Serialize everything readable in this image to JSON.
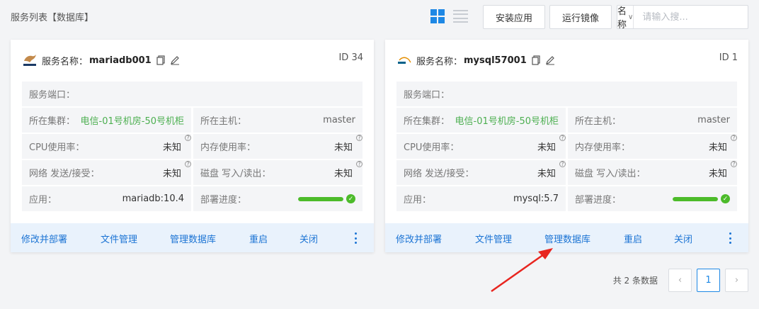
{
  "header": {
    "title": "服务列表【数据库】",
    "view_grid_icon": "grid-view-icon",
    "view_list_icon": "list-view-icon",
    "install_label": "安装应用",
    "run_image_label": "运行镜像",
    "search_field_label": "名称",
    "search_placeholder": "请输入搜..."
  },
  "cards": [
    {
      "logo": "mariadb-logo",
      "name_label": "服务名称：",
      "name": "mariadb001",
      "id_text": "ID 34",
      "port_label": "服务端口：",
      "cluster_label": "所在集群：",
      "cluster_value": "电信-01号机房-50号机柜",
      "host_label": "所在主机：",
      "host_value": "master",
      "cpu_label": "CPU使用率：",
      "cpu_value": "未知",
      "mem_label": "内存使用率：",
      "mem_value": "未知",
      "net_label": "网络 发送/接受：",
      "net_value": "未知",
      "disk_label": "磁盘 写入/读出：",
      "disk_value": "未知",
      "app_label": "应用：",
      "app_value": "mariadb:10.4",
      "deploy_label": "部署进度：",
      "deploy_progress": 1.0,
      "actions": {
        "modify": "修改并部署",
        "files": "文件管理",
        "db": "管理数据库",
        "restart": "重启",
        "close": "关闭"
      }
    },
    {
      "logo": "mysql-logo",
      "name_label": "服务名称：",
      "name": "mysql57001",
      "id_text": "ID 1",
      "port_label": "服务端口：",
      "cluster_label": "所在集群：",
      "cluster_value": "电信-01号机房-50号机柜",
      "host_label": "所在主机：",
      "host_value": "master",
      "cpu_label": "CPU使用率：",
      "cpu_value": "未知",
      "mem_label": "内存使用率：",
      "mem_value": "未知",
      "net_label": "网络 发送/接受：",
      "net_value": "未知",
      "disk_label": "磁盘 写入/读出：",
      "disk_value": "未知",
      "app_label": "应用：",
      "app_value": "mysql:5.7",
      "deploy_label": "部署进度：",
      "deploy_progress": 1.0,
      "actions": {
        "modify": "修改并部署",
        "files": "文件管理",
        "db": "管理数据库",
        "restart": "重启",
        "close": "关闭"
      }
    }
  ],
  "pagination": {
    "total_text": "共 2 条数据",
    "current_page": "1",
    "prev_icon": "‹",
    "next_icon": "›"
  },
  "colors": {
    "accent": "#1e88e5",
    "link": "#1c74d4",
    "green": "#4cbb2a",
    "annotation_arrow": "#e8251f"
  }
}
